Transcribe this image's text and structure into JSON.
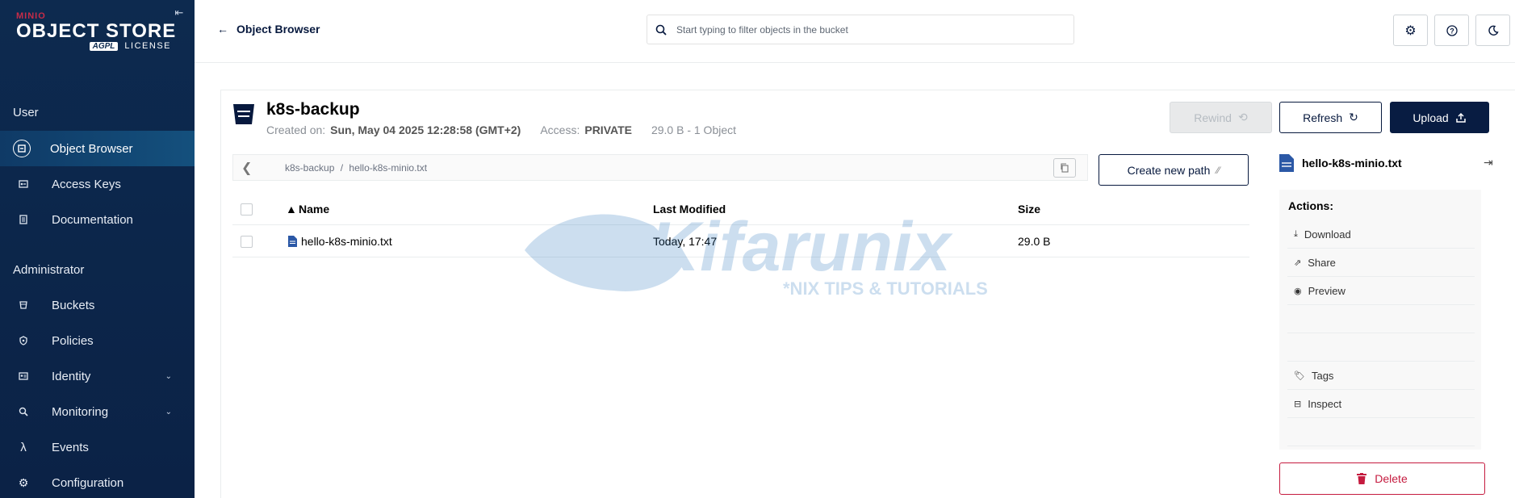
{
  "sidebar": {
    "brand": "MINIO",
    "product": "OBJECT STORE",
    "license_badge": "AGPL",
    "license_label": "LICENSE",
    "sections": {
      "user": "User",
      "administrator": "Administrator"
    },
    "items": [
      {
        "label": "Object Browser",
        "icon": "object-browser-icon",
        "active": true
      },
      {
        "label": "Access Keys",
        "icon": "key-icon"
      },
      {
        "label": "Documentation",
        "icon": "document-icon"
      },
      {
        "label": "Buckets",
        "icon": "bucket-icon"
      },
      {
        "label": "Policies",
        "icon": "shield-icon"
      },
      {
        "label": "Identity",
        "icon": "identity-icon",
        "expandable": true
      },
      {
        "label": "Monitoring",
        "icon": "monitoring-icon",
        "expandable": true
      },
      {
        "label": "Events",
        "icon": "lambda-icon"
      },
      {
        "label": "Configuration",
        "icon": "gear-icon"
      }
    ]
  },
  "topbar": {
    "back_label": "Object Browser",
    "search_placeholder": "Start typing to filter objects in the bucket"
  },
  "bucket": {
    "name": "k8s-backup",
    "created_label": "Created on:",
    "created_value": "Sun, May 04 2025 12:28:58 (GMT+2)",
    "access_label": "Access:",
    "access_value": "PRIVATE",
    "summary": "29.0 B - 1 Object",
    "buttons": {
      "rewind": "Rewind",
      "refresh": "Refresh",
      "upload": "Upload"
    }
  },
  "breadcrumb": {
    "bucket": "k8s-backup",
    "separator": "/",
    "object": "hello-k8s-minio.txt",
    "create_new_path": "Create new path"
  },
  "table": {
    "columns": {
      "name": "Name",
      "modified": "Last Modified",
      "size": "Size"
    },
    "rows": [
      {
        "name": "hello-k8s-minio.txt",
        "modified": "Today, 17:47",
        "size": "29.0 B"
      }
    ]
  },
  "object_panel": {
    "title": "hello-k8s-minio.txt",
    "actions_label": "Actions:",
    "actions": [
      {
        "label": "Download",
        "icon": "download-icon"
      },
      {
        "label": "Share",
        "icon": "share-icon"
      },
      {
        "label": "Preview",
        "icon": "eye-icon"
      },
      {
        "label": "Tags",
        "icon": "tag-icon"
      },
      {
        "label": "Inspect",
        "icon": "inspect-icon"
      }
    ],
    "delete_label": "Delete"
  },
  "watermark": {
    "text": "Kifarunix",
    "tagline": "*NIX TIPS & TUTORIALS"
  },
  "colors": {
    "sidebar_bg": "#0d2a4f",
    "primary_dark": "#081c42",
    "danger": "#c51b3f",
    "brand_red": "#c72c48"
  }
}
